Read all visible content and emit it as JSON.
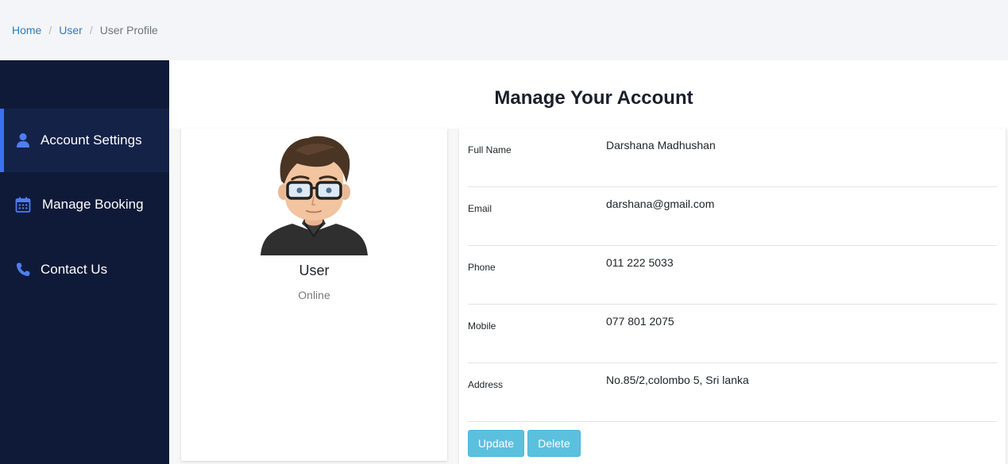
{
  "breadcrumb": {
    "home": "Home",
    "separator": "/",
    "user": "User",
    "current": "User Profile"
  },
  "sidebar": {
    "items": [
      {
        "label": "Account Settings",
        "icon": "user-icon",
        "active": true
      },
      {
        "label": "Manage Booking",
        "icon": "calendar-icon",
        "active": false
      },
      {
        "label": "Contact Us",
        "icon": "phone-icon",
        "active": false
      }
    ]
  },
  "page": {
    "title": "Manage Your Account"
  },
  "profile": {
    "name": "User",
    "status": "Online"
  },
  "details": {
    "rows": [
      {
        "label": "Full Name",
        "value": "Darshana Madhushan"
      },
      {
        "label": "Email",
        "value": "darshana@gmail.com"
      },
      {
        "label": "Phone",
        "value": "011 222 5033"
      },
      {
        "label": "Mobile",
        "value": "077 801 2075"
      },
      {
        "label": "Address",
        "value": "No.85/2,colombo 5, Sri lanka"
      }
    ]
  },
  "actions": {
    "update_label": "Update",
    "delete_label": "Delete"
  },
  "colors": {
    "sidebar_bg": "#0f1a38",
    "accent": "#3d6ff2",
    "link": "#337ab7",
    "button": "#5bc0de"
  }
}
